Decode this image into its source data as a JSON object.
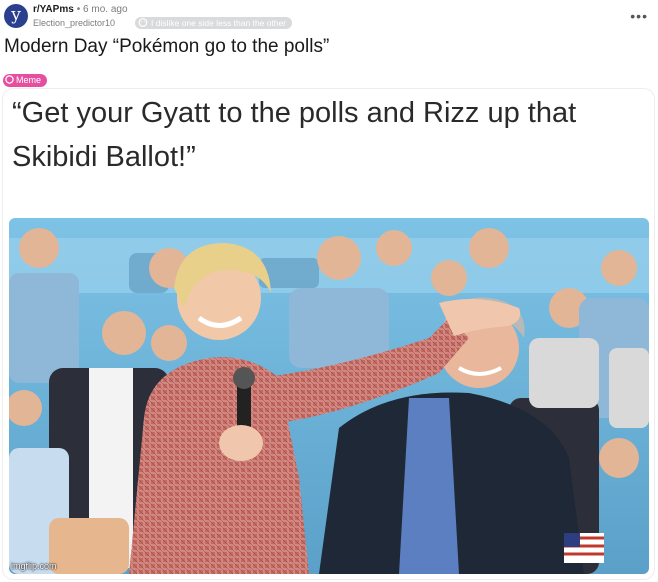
{
  "post": {
    "subreddit": "r/YAPms",
    "time": "• 6 mo. ago",
    "author": "Election_predictor10",
    "author_flair": "I dislike one side less than the other",
    "title": "Modern Day “Pokémon go to the polls”",
    "flair": "Meme",
    "avatar_letter": "y"
  },
  "meme": {
    "caption": "“Get your Gyatt to the polls and Rizz up that Skibidi Ballot!”",
    "watermark": "imgflip.com"
  },
  "colors": {
    "accent_flair": "#e64fa0",
    "avatar_bg": "#2b3f8f",
    "backdrop": "#8ec9e6"
  },
  "icons": [
    "more-options-icon",
    "user-flair-icon",
    "meme-flair-icon"
  ]
}
